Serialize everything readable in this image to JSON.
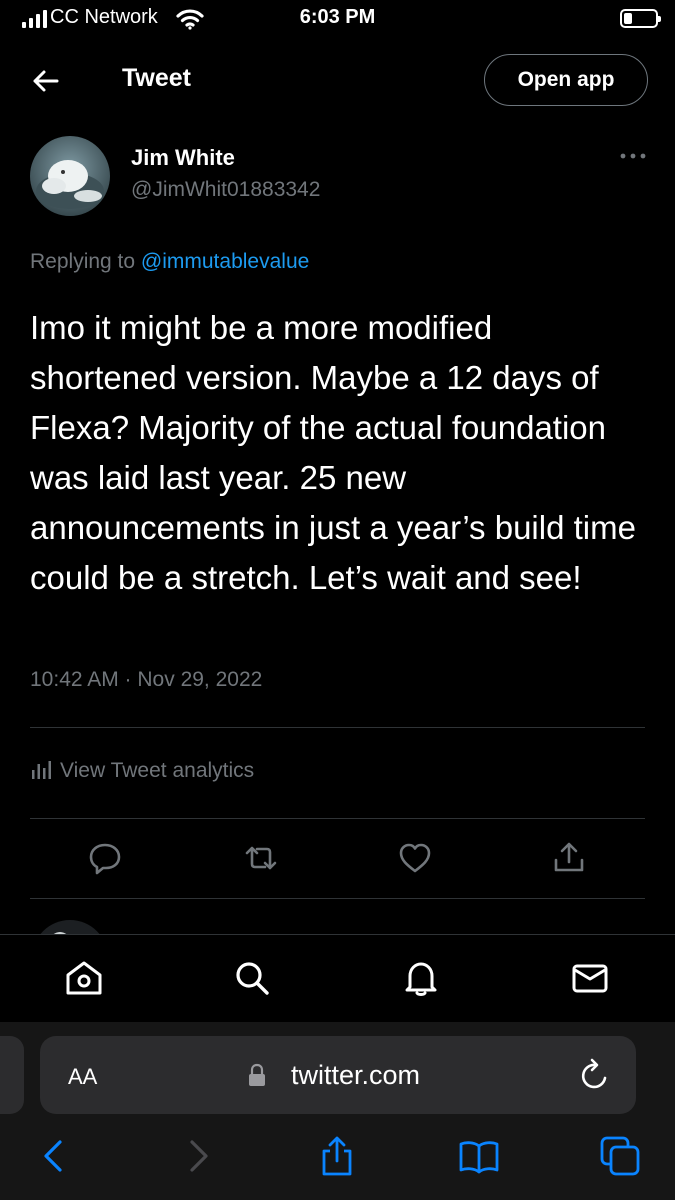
{
  "status_bar": {
    "carrier": "CC Network",
    "time": "6:03 PM"
  },
  "header": {
    "title": "Tweet",
    "open_app_label": "Open app"
  },
  "tweet": {
    "author_name": "Jim White",
    "author_handle": "@JimWhit01883342",
    "replying_prefix": "Replying to",
    "replying_to": "@immutablevalue",
    "text": "Imo it might be a more modified shortened version. Maybe a 12 days of Flexa?  Majority of the actual foundation was laid last year. 25 new announcements in just a year’s build time could be a stretch. Let’s wait and see!",
    "timestamp": "10:42 AM · Nov 29, 2022",
    "analytics_label": "View Tweet analytics"
  },
  "tab_bar": {
    "items": [
      "home-icon",
      "search-icon",
      "notifications-icon",
      "messages-icon"
    ]
  },
  "browser": {
    "text_size_label": "AA",
    "url": "twitter.com"
  },
  "colors": {
    "background": "#000000",
    "accent": "#1d9bf0",
    "muted": "#71767b",
    "divider": "#2f3336"
  }
}
